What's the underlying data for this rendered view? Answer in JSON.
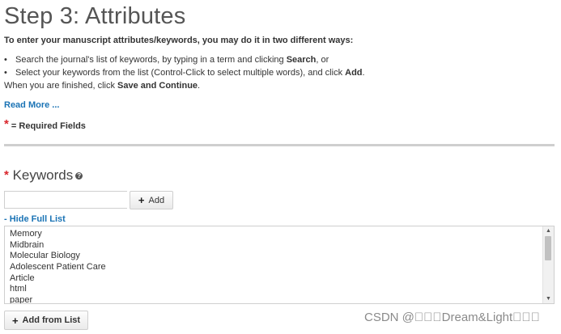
{
  "page": {
    "title": "Step 3: Attributes",
    "intro": "To enter your manuscript attributes/keywords, you may do it in two different ways:",
    "bullets": [
      {
        "text": "Search the journal's list of keywords, by typing in a term and clicking ",
        "bold": "Search",
        "suffix": ", or"
      },
      {
        "text": "Select your keywords from the list (Control-Click to select multiple words), and click ",
        "bold": "Add",
        "suffix": "."
      }
    ],
    "finish": {
      "text": "When you are finished, click ",
      "bold": "Save and Continue",
      "suffix": "."
    },
    "read_more": "Read More ...",
    "required_star": "*",
    "required_text": "= Required Fields"
  },
  "keywords": {
    "star": "*",
    "label": "Keywords",
    "help_icon": "?",
    "input_value": "",
    "add_plus": "+",
    "add_label": "Add",
    "hide_list": "- Hide Full List",
    "list_items": [
      "Memory",
      "Midbrain",
      "Molecular Biology",
      "Adolescent Patient Care",
      "Article",
      "html",
      "paper"
    ],
    "add_from_list_label": "Add from List"
  },
  "watermark": "CSDN @\u0000\u0000\u0000Dream&Light\u0000\u0000\u0000",
  "colors": {
    "link": "#1a73b5",
    "required": "#d9262c",
    "divider": "#cfcfcf"
  }
}
